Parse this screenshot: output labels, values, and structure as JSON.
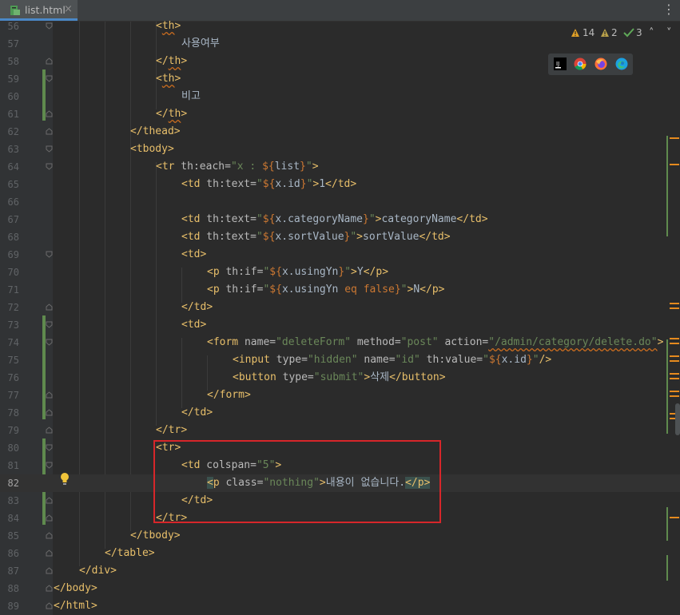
{
  "tab": {
    "filename": "list.html",
    "close": "×",
    "file_icon": "html-file-icon"
  },
  "tab_menu_icon": "⋮",
  "inspections": {
    "warnings": "14",
    "weak_warnings": "2",
    "typos": "3",
    "up": "˄",
    "down": "˅"
  },
  "browsers": [
    "intellij-icon",
    "chrome-icon",
    "firefox-icon",
    "edge-icon"
  ],
  "current_line": "82",
  "lines": [
    {
      "n": "56",
      "i": 0
    },
    {
      "n": "57",
      "i": 1
    },
    {
      "n": "58",
      "i": 2
    },
    {
      "n": "59",
      "i": 3
    },
    {
      "n": "60",
      "i": 4
    },
    {
      "n": "61",
      "i": 5
    },
    {
      "n": "62",
      "i": 6
    },
    {
      "n": "63",
      "i": 7
    },
    {
      "n": "64",
      "i": 8
    },
    {
      "n": "65",
      "i": 9
    },
    {
      "n": "66",
      "i": 10
    },
    {
      "n": "67",
      "i": 11
    },
    {
      "n": "68",
      "i": 12
    },
    {
      "n": "69",
      "i": 13
    },
    {
      "n": "70",
      "i": 14
    },
    {
      "n": "71",
      "i": 15
    },
    {
      "n": "72",
      "i": 16
    },
    {
      "n": "73",
      "i": 17
    },
    {
      "n": "74",
      "i": 18
    },
    {
      "n": "75",
      "i": 19
    },
    {
      "n": "76",
      "i": 20
    },
    {
      "n": "77",
      "i": 21
    },
    {
      "n": "78",
      "i": 22
    },
    {
      "n": "79",
      "i": 23
    },
    {
      "n": "80",
      "i": 24
    },
    {
      "n": "81",
      "i": 25
    },
    {
      "n": "82",
      "i": 26
    },
    {
      "n": "83",
      "i": 27
    },
    {
      "n": "84",
      "i": 28
    },
    {
      "n": "85",
      "i": 29
    },
    {
      "n": "86",
      "i": 30
    },
    {
      "n": "87",
      "i": 31
    },
    {
      "n": "88",
      "i": 32
    },
    {
      "n": "89",
      "i": 33
    }
  ],
  "code": {
    "l56": [
      "<",
      "th",
      ">"
    ],
    "l57": "사용여부",
    "l58": [
      "</",
      "th",
      ">"
    ],
    "l59": [
      "<",
      "th",
      ">"
    ],
    "l60": "비고",
    "l61": [
      "</",
      "th",
      ">"
    ],
    "l62": [
      "</",
      "thead",
      ">"
    ],
    "l63": [
      "<",
      "tbody",
      ">"
    ],
    "l64": {
      "open": "<",
      "tag": "tr",
      "attr": " th:each=",
      "q1": "\"x : ",
      "ex1": "${",
      "var": "list",
      "ex2": "}",
      "q2": "\"",
      "close": ">"
    },
    "l65": {
      "open": "<",
      "tag": "td",
      "attr": " th:text=",
      "q1": "\"",
      "ex1": "${",
      "var": "x.id",
      "ex2": "}",
      "q2": "\"",
      "close": ">",
      "text": "1",
      "etag_o": "</",
      "etag": "td",
      "etag_c": ">"
    },
    "l67": {
      "open": "<",
      "tag": "td",
      "attr": " th:text=",
      "q1": "\"",
      "ex1": "${",
      "var": "x.categoryName",
      "ex2": "}",
      "q2": "\"",
      "close": ">",
      "text": "categoryName",
      "etag_o": "</",
      "etag": "td",
      "etag_c": ">"
    },
    "l68": {
      "open": "<",
      "tag": "td",
      "attr": " th:text=",
      "q1": "\"",
      "ex1": "${",
      "var": "x.sortValue",
      "ex2": "}",
      "q2": "\"",
      "close": ">",
      "text": "sortValue",
      "etag_o": "</",
      "etag": "td",
      "etag_c": ">"
    },
    "l69": [
      "<",
      "td",
      ">"
    ],
    "l70": {
      "open": "<",
      "tag": "p",
      "attr": " th:if=",
      "q1": "\"",
      "ex1": "${",
      "var": "x.usingYn",
      "ex2": "}",
      "q2": "\"",
      "close": ">",
      "text": "Y",
      "etag_o": "</",
      "etag": "p",
      "etag_c": ">"
    },
    "l71": {
      "open": "<",
      "tag": "p",
      "attr": " th:if=",
      "q1": "\"",
      "ex1": "${",
      "var": "x.usingYn ",
      "kw1": "eq",
      "sp": " ",
      "kw2": "false",
      "ex2": "}",
      "q2": "\"",
      "close": ">",
      "text": "N",
      "etag_o": "</",
      "etag": "p",
      "etag_c": ">"
    },
    "l72": [
      "</",
      "td",
      ">"
    ],
    "l73": [
      "<",
      "td",
      ">"
    ],
    "l74": {
      "open": "<",
      "tag": "form",
      "a1": " name=",
      "v1": "\"deleteForm\"",
      "a2": " method=",
      "v2": "\"post\"",
      "a3": " action=",
      "v3": "\"/admin/category/delete.do\"",
      "close": ">"
    },
    "l75": {
      "open": "<",
      "tag": "input",
      "a1": " type=",
      "v1": "\"hidden\"",
      "a2": " name=",
      "v2": "\"id\"",
      "a3": " th:value=",
      "q1": "\"",
      "ex1": "${",
      "var": "x.id",
      "ex2": "}",
      "q2": "\"",
      "close": "/>"
    },
    "l76": {
      "open": "<",
      "tag": "button",
      "a1": " type=",
      "v1": "\"submit\"",
      "close": ">",
      "text": "삭제",
      "etag_o": "</",
      "etag": "button",
      "etag_c": ">"
    },
    "l77": [
      "</",
      "form",
      ">"
    ],
    "l78": [
      "</",
      "td",
      ">"
    ],
    "l79": [
      "</",
      "tr",
      ">"
    ],
    "l80": [
      "<",
      "tr",
      ">"
    ],
    "l81": {
      "open": "<",
      "tag": "td",
      "a1": " colspan=",
      "v1": "\"5\"",
      "close": ">"
    },
    "l82": {
      "open": "<",
      "tag": "p",
      "a1": " class=",
      "v1": "\"nothing\"",
      "close": ">",
      "text": "내용이 없습니다.",
      "etag_o": "</",
      "etag": "p",
      "etag_c": ">"
    },
    "l83": [
      "</",
      "td",
      ">"
    ],
    "l84": [
      "</",
      "tr",
      ">"
    ],
    "l85": [
      "</",
      "tbody",
      ">"
    ],
    "l86": [
      "</",
      "table",
      ">"
    ],
    "l87": [
      "</",
      "div",
      ">"
    ],
    "l88": [
      "</",
      "body",
      ">"
    ],
    "l89": [
      "</",
      "html",
      ">"
    ]
  },
  "colors": {
    "background": "#2b2b2b",
    "tag": "#e8bf6a",
    "attribute": "#bababa",
    "string": "#6a8759",
    "keyword": "#cc7832",
    "highlight_box": "#d7262a"
  }
}
